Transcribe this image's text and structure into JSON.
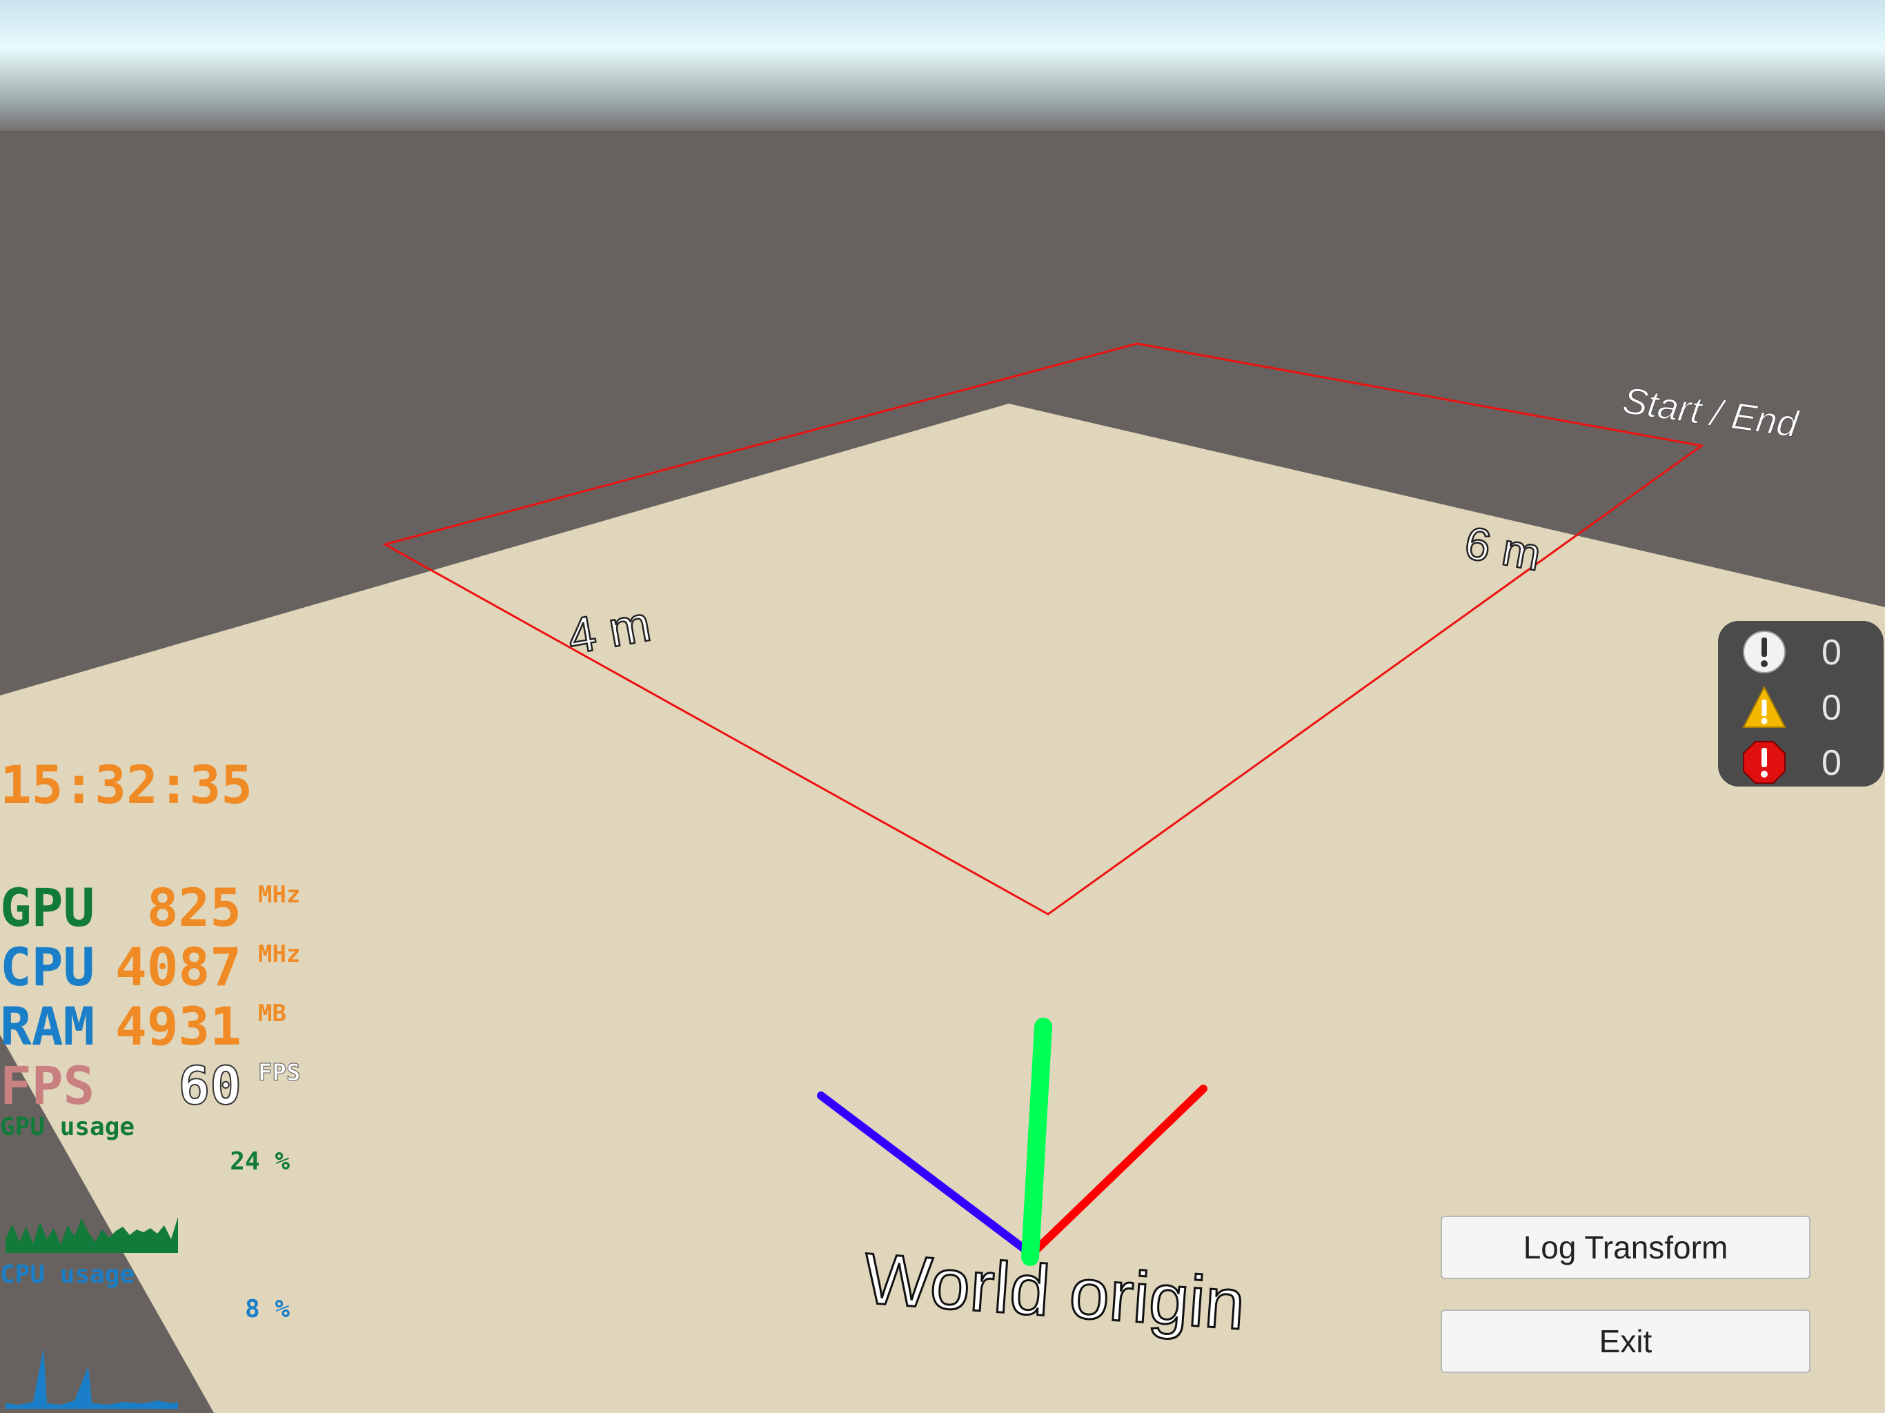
{
  "scene": {
    "labels": {
      "start_end": "Start / End",
      "side_a": "6 m",
      "side_b": "4 m",
      "world_origin": "World origin"
    }
  },
  "hud": {
    "clock": "15:32:35",
    "stats": [
      {
        "name": "GPU",
        "value": "825",
        "unit": "MHz",
        "name_color": "#127a3a"
      },
      {
        "name": "CPU",
        "value": "4087",
        "unit": "MHz",
        "name_color": "#1a7fc8"
      },
      {
        "name": "RAM",
        "value": "4931",
        "unit": "MB",
        "name_color": "#1a7fc8"
      },
      {
        "name": "FPS",
        "value": "60",
        "unit": "FPS",
        "name_color": "#c98080"
      }
    ],
    "gpu_usage": {
      "label": "GPU usage",
      "percent": "24",
      "unit": "%",
      "color": "#127a3a"
    },
    "cpu_usage": {
      "label": "CPU usage",
      "percent": "8",
      "unit": "%",
      "color": "#1a7fc8"
    }
  },
  "console": {
    "info_count": "0",
    "warning_count": "0",
    "error_count": "0"
  },
  "buttons": {
    "log_transform": "Log Transform",
    "exit": "Exit"
  },
  "colors": {
    "sky_top": "#cfe9f0",
    "ground": "#67625f",
    "floor": "#e0d6bb",
    "boundary": "#ee1111",
    "axis_x": "#ff0000",
    "axis_y": "#00ff55",
    "axis_z": "#3300ff"
  }
}
